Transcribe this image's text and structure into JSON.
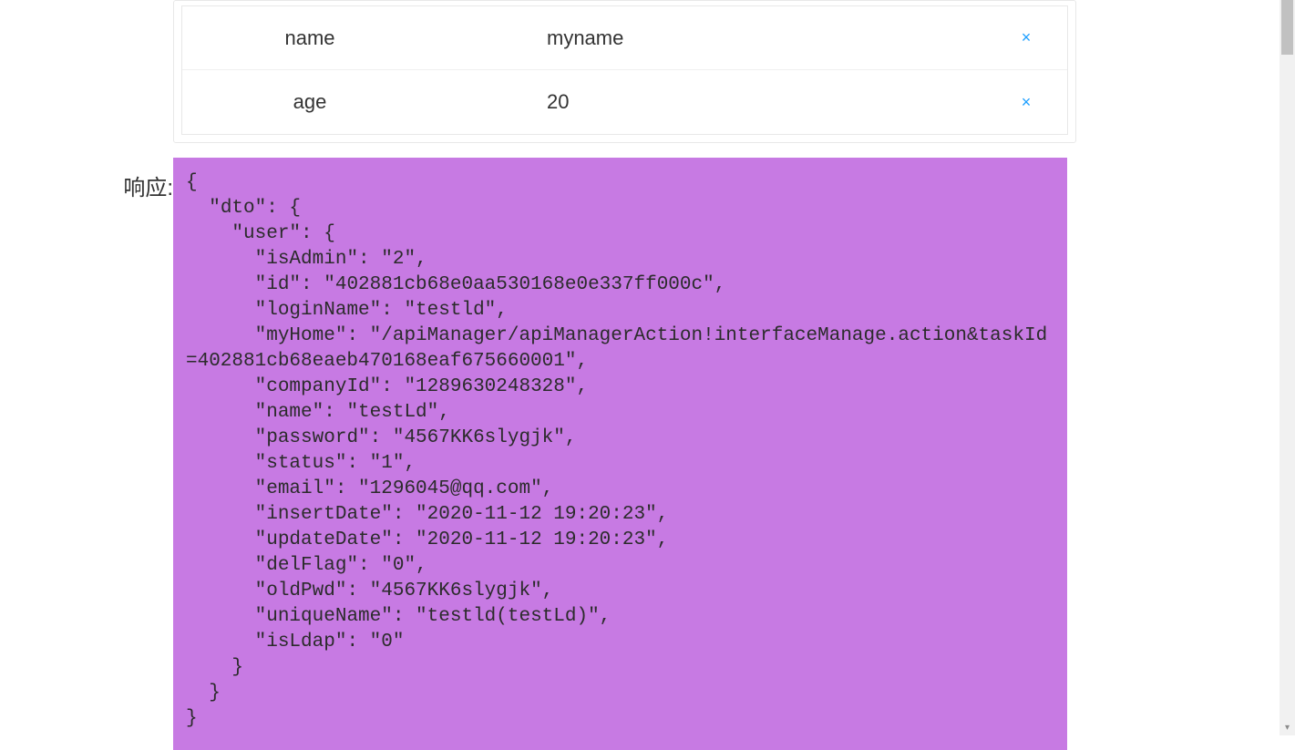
{
  "params": {
    "rows": [
      {
        "key": "name",
        "value": "myname",
        "delete_icon": "×"
      },
      {
        "key": "age",
        "value": "20",
        "delete_icon": "×"
      }
    ]
  },
  "response": {
    "label": "响应:",
    "body": "{\n  \"dto\": {\n    \"user\": {\n      \"isAdmin\": \"2\",\n      \"id\": \"402881cb68e0aa530168e0e337ff000c\",\n      \"loginName\": \"testld\",\n      \"myHome\": \"/apiManager/apiManagerAction!interfaceManage.action&taskId=402881cb68eaeb470168eaf675660001\",\n      \"companyId\": \"1289630248328\",\n      \"name\": \"testLd\",\n      \"password\": \"4567KK6slygjk\",\n      \"status\": \"1\",\n      \"email\": \"1296045@qq.com\",\n      \"insertDate\": \"2020-11-12 19:20:23\",\n      \"updateDate\": \"2020-11-12 19:20:23\",\n      \"delFlag\": \"0\",\n      \"oldPwd\": \"4567KK6slygjk\",\n      \"uniqueName\": \"testld(testLd)\",\n      \"isLdap\": \"0\"\n    }\n  }\n}"
  }
}
